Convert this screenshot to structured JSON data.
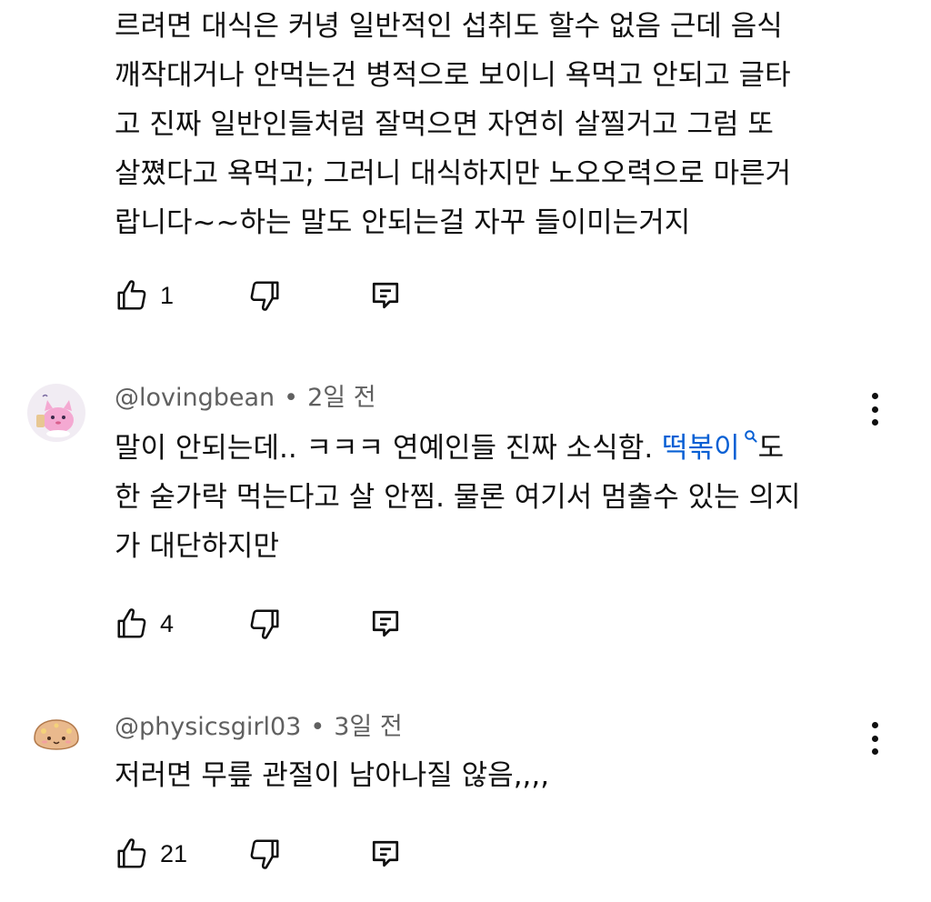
{
  "comments": [
    {
      "lines": [
        "르려면 대식은 커녕 일반적인 섭취도 할수 없음 근데 음식",
        "깨작대거나 안먹는건 병적으로 보이니 욕먹고 안되고 글타",
        "고 진짜 일반인들처럼 잘먹으면 자연히 살찔거고 그럼 또",
        "살쪘다고 욕먹고; 그러니 대식하지만 노오오력으로 마른거",
        "랍니다~~하는 말도 안되는걸 자꾸 들이미는거지"
      ],
      "likes": "1"
    },
    {
      "author": "@lovingbean",
      "time": "2일 전",
      "text_before_link": "말이 안되는데.. ㅋㅋㅋ 연예인들 진짜 소식함. ",
      "link_text": "떡볶이",
      "text_after_link": "도",
      "lines": [
        "한 숟가락 먹는다고 살 안찜. 물론 여기서 멈출수 있는 의지",
        "가 대단하지만"
      ],
      "likes": "4"
    },
    {
      "author": "@physicsgirl03",
      "time": "3일 전",
      "lines": [
        "저러면 무릎 관절이 남아나질 않음,,,,"
      ],
      "likes": "21"
    }
  ],
  "meta_separator": "•",
  "colors": {
    "text": "#0f0f0f",
    "meta": "#606060",
    "link": "#065fd4"
  },
  "icons": {
    "like": "thumbs-up-icon",
    "dislike": "thumbs-down-icon",
    "reply": "reply-icon",
    "more": "more-vert-icon",
    "search": "search-icon"
  }
}
